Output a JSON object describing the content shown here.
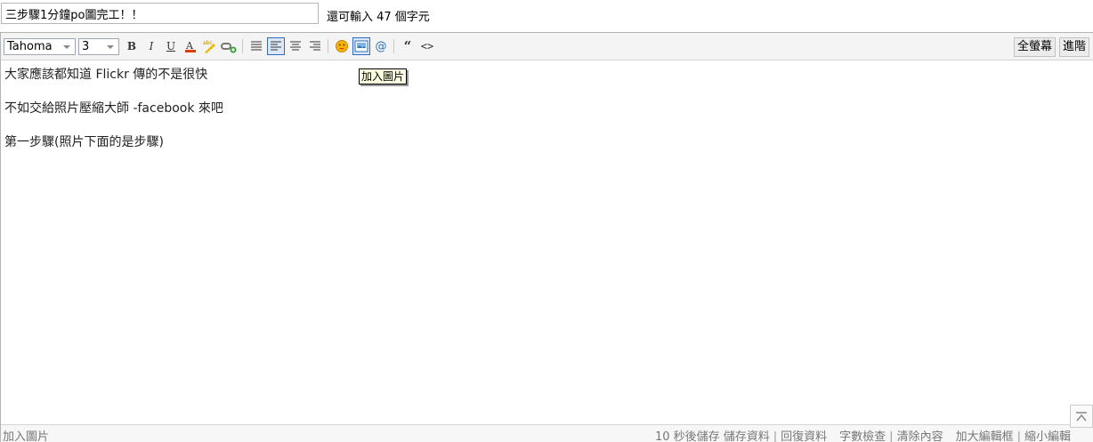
{
  "title_input": {
    "value": "三步驟1分鐘po圖完工！！"
  },
  "char_remaining": "還可輸入 47 個字元",
  "toolbar": {
    "font_family": "Tahoma",
    "font_size": "3",
    "bold": "B",
    "italic": "I",
    "underline": "U",
    "quote": "“",
    "code": "<>",
    "at": "@",
    "fullscreen": "全螢幕",
    "advanced": "進階"
  },
  "tooltip": "加入圖片",
  "content": {
    "lines": [
      "大家應該都知道 Flickr 傳的不是很快",
      "不如交給照片壓縮大師 -facebook 來吧",
      "第一步驟(照片下面的是步驟)"
    ]
  },
  "status": {
    "left": "加入圖片",
    "autosave": "10 秒後儲存 儲存資料",
    "restore": "回復資料",
    "word_count": "字數檢查",
    "clear": "清除內容",
    "enlarge": "加大編輯框",
    "shrink": "縮小編輯"
  }
}
